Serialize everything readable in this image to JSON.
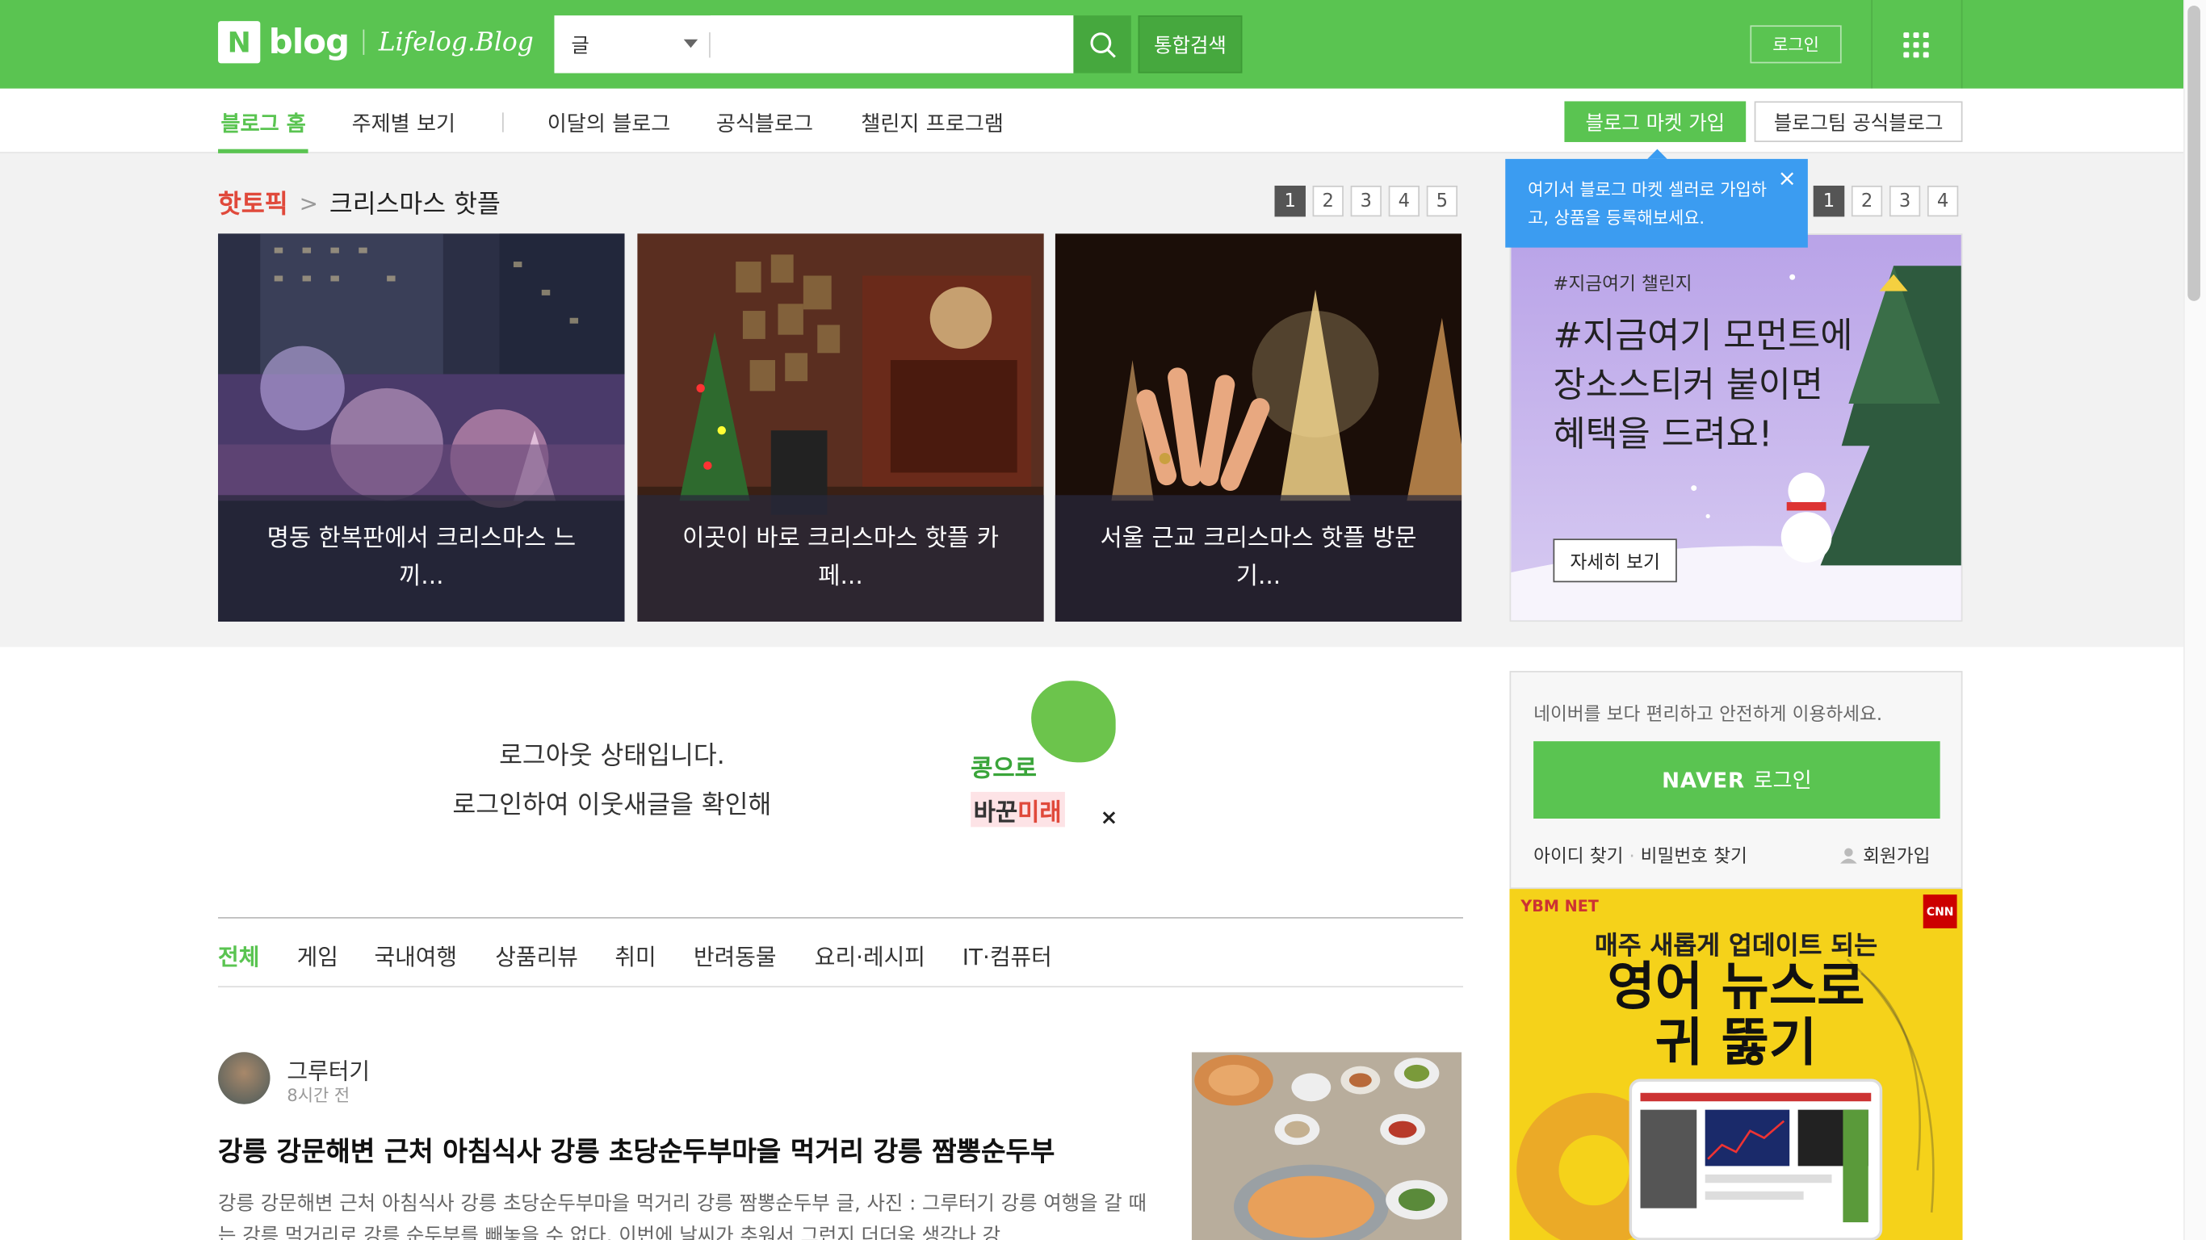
{
  "header": {
    "logo_n": "N",
    "logo_blog": "blog",
    "logo_sub": "Lifelog.Blog",
    "search_category": "글",
    "search_placeholder": "",
    "total_search": "통합검색",
    "login": "로그인"
  },
  "subnav": {
    "items": [
      "블로그 홈",
      "주제별 보기",
      "이달의 블로그",
      "공식블로그",
      "챌린지 프로그램"
    ],
    "market_join": "블로그 마켓 가입",
    "official_team": "블로그팀 공식블로그"
  },
  "hot": {
    "label": "핫토픽",
    "topic": "크리스마스 핫플",
    "pages": [
      "1",
      "2",
      "3",
      "4",
      "5"
    ],
    "cards": [
      {
        "caption": "명동 한복판에서 크리스마스 느끼..."
      },
      {
        "caption": "이곳이 바로 크리스마스 핫플 카페..."
      },
      {
        "caption": "서울 근교 크리스마스 핫플 방문기..."
      }
    ]
  },
  "tooltip": {
    "text": "여기서 블로그 마켓 셀러로 가입하고, 상품을 등록해보세요.",
    "close": "×"
  },
  "promo": {
    "pages": [
      "1",
      "2",
      "3",
      "4"
    ],
    "tag": "#지금여기 챌린지",
    "headline": "#지금여기 모먼트에 장소스티커 붙이면 혜택을 드려요!",
    "more": "자세히 보기"
  },
  "logout_banner": {
    "line1": "로그아웃 상태입니다.",
    "line2": "로그인하여 이웃새글을 확인해",
    "kong": "콩으로",
    "bakwon_a": "바꾼",
    "bakwon_b": "미래",
    "close": "×"
  },
  "categories": [
    "전체",
    "게임",
    "국내여행",
    "상품리뷰",
    "취미",
    "반려동물",
    "요리·레시피",
    "IT·컴퓨터"
  ],
  "post": {
    "author": "그루터기",
    "time": "8시간 전",
    "title": "강릉 강문해변 근처 아침식사 강릉 초당순두부마을 먹거리 강릉 짬뽕순두부",
    "body": "강릉 강문해변 근처 아침식사 강릉 초당순두부마을 먹거리 강릉 짬뽕순두부 글, 사진 : 그루터기 강릉 여행을 갈 때는 강릉 먹거리로 강릉 순두부를 빼놓을 수 없다. 이번에 날씨가 추워서 그런지 더더욱 생각나 강"
  },
  "login_box": {
    "text": "네이버를 보다 편리하고 안전하게 이용하세요.",
    "naver": "NAVER",
    "login": "로그인",
    "find_id": "아이디 찾기",
    "find_pw": "비밀번호 찾기",
    "join": "회원가입"
  },
  "ad": {
    "ybm": "YBM NET",
    "cnn": "CNN",
    "line1": "매주 새롭게 업데이트 되는",
    "line2": "영어 뉴스로",
    "line3": "귀 뚫기"
  }
}
